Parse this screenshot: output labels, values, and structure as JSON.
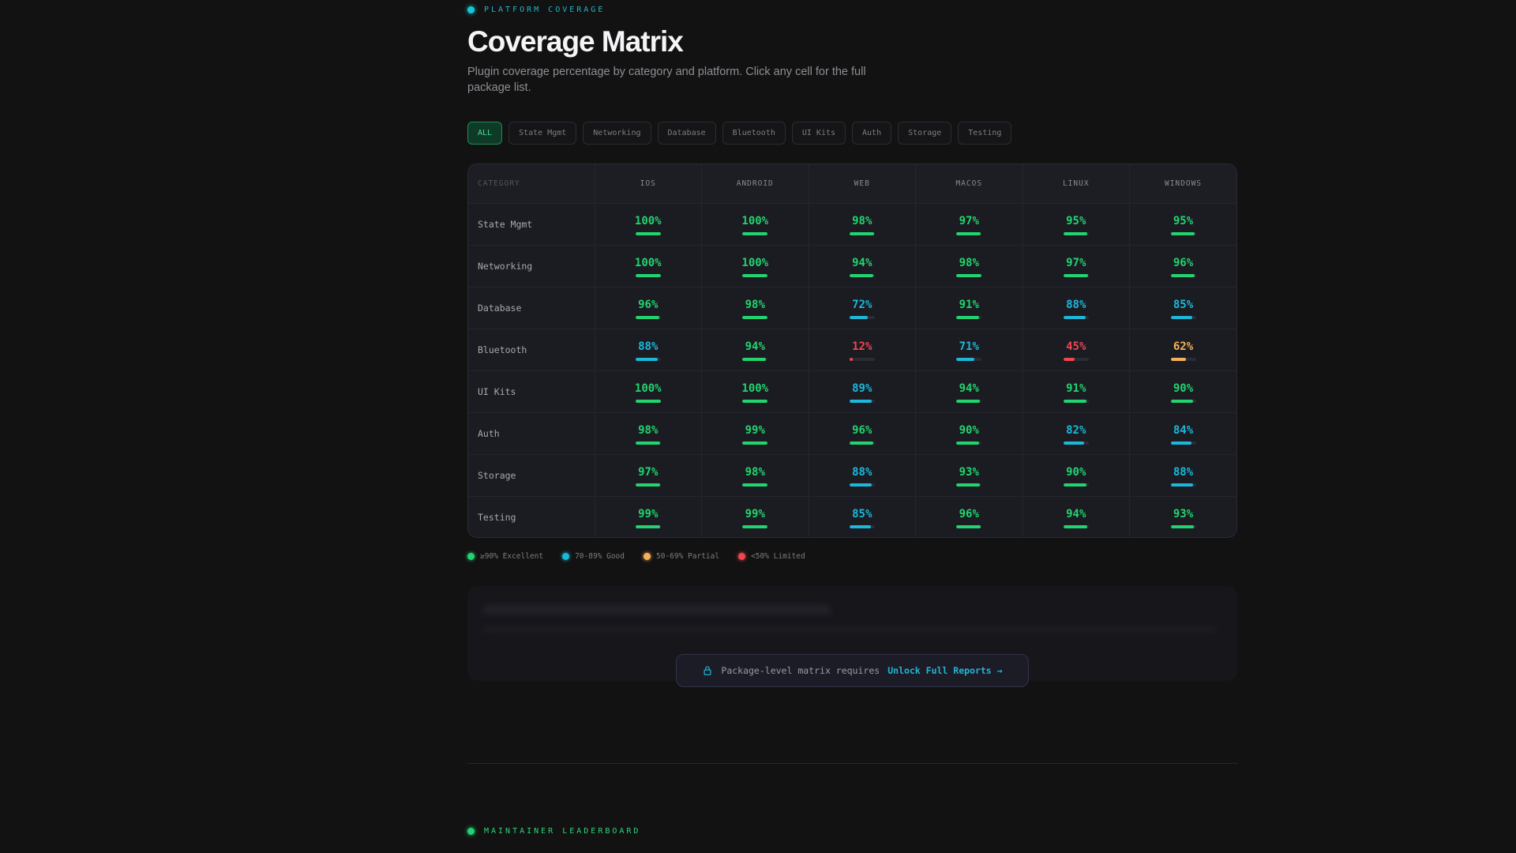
{
  "header": {
    "eyebrow": "PLATFORM COVERAGE",
    "title": "Coverage Matrix",
    "subtitle": "Plugin coverage percentage by category and platform. Click any cell for the full package list."
  },
  "filters": [
    "ALL",
    "State Mgmt",
    "Networking",
    "Database",
    "Bluetooth",
    "UI Kits",
    "Auth",
    "Storage",
    "Testing"
  ],
  "matrix": {
    "category_label": "CATEGORY",
    "platforms": [
      "IOS",
      "ANDROID",
      "WEB",
      "MACOS",
      "LINUX",
      "WINDOWS"
    ],
    "rows": [
      {
        "category": "State Mgmt",
        "values": [
          100,
          100,
          98,
          97,
          95,
          95
        ]
      },
      {
        "category": "Networking",
        "values": [
          100,
          100,
          94,
          98,
          97,
          96
        ]
      },
      {
        "category": "Database",
        "values": [
          96,
          98,
          72,
          91,
          88,
          85
        ]
      },
      {
        "category": "Bluetooth",
        "values": [
          88,
          94,
          12,
          71,
          45,
          62
        ]
      },
      {
        "category": "UI Kits",
        "values": [
          100,
          100,
          89,
          94,
          91,
          90
        ]
      },
      {
        "category": "Auth",
        "values": [
          98,
          99,
          96,
          90,
          82,
          84
        ]
      },
      {
        "category": "Storage",
        "values": [
          97,
          98,
          88,
          93,
          90,
          88
        ]
      },
      {
        "category": "Testing",
        "values": [
          99,
          99,
          85,
          96,
          94,
          93
        ]
      }
    ]
  },
  "legend": [
    {
      "label": "≥90% Excellent",
      "color": "#22d36f"
    },
    {
      "label": "70-89% Good",
      "color": "#1cb8d9"
    },
    {
      "label": "50-69% Partial",
      "color": "#f3b25a"
    },
    {
      "label": "<50% Limited",
      "color": "#f0464f"
    }
  ],
  "colors": {
    "excellent": "#22d36f",
    "good": "#1cb8d9",
    "partial": "#f3b25a",
    "limited": "#f0464f"
  },
  "unlock": {
    "text": "Package-level matrix requires",
    "link": "Unlock Full Reports →"
  },
  "next_section": {
    "eyebrow": "MAINTAINER LEADERBOARD"
  }
}
